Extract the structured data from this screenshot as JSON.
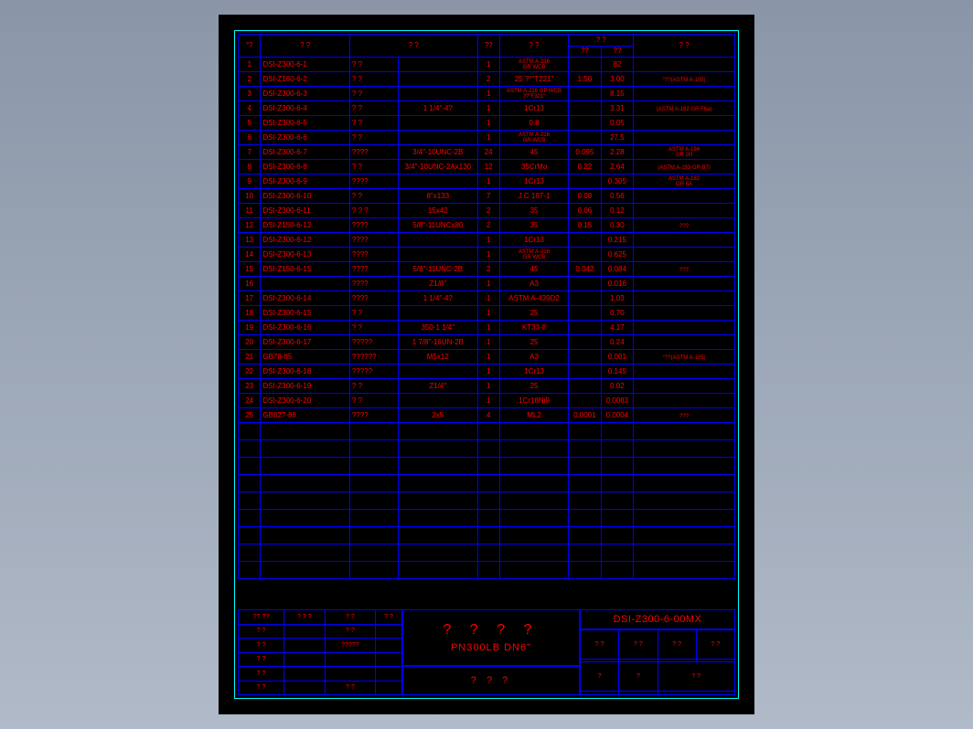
{
  "header": {
    "c1": "°?",
    "c2": "?    ?",
    "c3": "?    ?",
    "c4": "??",
    "c5": "?  ?",
    "c6a": "? ?",
    "c6b": "??",
    "c6c": "??",
    "c7": "?    ?"
  },
  "rows": [
    {
      "n": "1",
      "code": "DSI-Z300-6-1",
      "name": "?   ?",
      "spec": "",
      "qty": "1",
      "mat": "ASTM A-216\nGR WCB",
      "w1": "",
      "w2": "82",
      "rem": ""
    },
    {
      "n": "2",
      "code": "DSI-Z150-6-2",
      "name": "?   ?",
      "spec": "",
      "qty": "2",
      "mat": "25 ?°\"T221\"",
      "w1": "1.50",
      "w2": "3.00",
      "rem": "°??(ASTM A-105)"
    },
    {
      "n": "3",
      "code": "DSI-Z300-6-3",
      "name": "?   ?",
      "spec": "",
      "qty": "1",
      "mat": "ASTM A-216 GP WCB\n??\"F321\"",
      "w1": "",
      "w2": "8.15",
      "rem": ""
    },
    {
      "n": "4",
      "code": "DSI-Z300-6-4",
      "name": "?   ?",
      "spec": "1 1/4\"-4?",
      "qty": "1",
      "mat": "1Cr13",
      "w1": "",
      "w2": "3.31",
      "rem": "(ASTM A-182 GR F6a)"
    },
    {
      "n": "5",
      "code": "DSI-Z300-6-5",
      "name": "?   ?",
      "spec": "",
      "qty": "1",
      "mat": "0.8",
      "w1": "",
      "w2": "0.05",
      "rem": ""
    },
    {
      "n": "6",
      "code": "DSI-Z300-6-6",
      "name": "?   ?",
      "spec": "",
      "qty": "1",
      "mat": "ASTM A-216\nGR WCB",
      "w1": "",
      "w2": "27.5",
      "rem": ""
    },
    {
      "n": "7",
      "code": "DSI-Z300-6-7",
      "name": "????",
      "spec": "3/4\"-10UNC-2B",
      "qty": "24",
      "mat": "45",
      "w1": "0.095",
      "w2": "2.28",
      "rem": "ASTM A-194\nGR 2H"
    },
    {
      "n": "8",
      "code": "DSI-Z300-6-8",
      "name": "?   ?",
      "spec": "3/4\"-10UNC-2Ax130",
      "qty": "12",
      "mat": "35CrMo",
      "w1": "0.22",
      "w2": "2.64",
      "rem": "(ASTM A-193 GR B7)"
    },
    {
      "n": "9",
      "code": "DSI-Z300-6-9",
      "name": "????",
      "spec": "",
      "qty": "1",
      "mat": "1Cr13",
      "w1": "",
      "w2": "0.305",
      "rem": "ASTM A-182\nGR 6A"
    },
    {
      "n": "10",
      "code": "DSI-Z300-6-10",
      "name": "?   ?",
      "spec": "8\"x133",
      "qty": "7",
      "mat": "J.C 187-1",
      "w1": "0.08",
      "w2": "0.56",
      "rem": ""
    },
    {
      "n": "11",
      "code": "DSI-Z300-6-11",
      "name": "? ? ?",
      "spec": "15x42",
      "qty": "2",
      "mat": "35",
      "w1": "0.06",
      "w2": "0.12",
      "rem": ""
    },
    {
      "n": "12",
      "code": "DSI-Z150-6-12",
      "name": "????",
      "spec": "5/8\"-11UNCx80",
      "qty": "2",
      "mat": "35",
      "w1": "0.15",
      "w2": "0.30",
      "rem": "???"
    },
    {
      "n": "13",
      "code": "DSI-Z300-6-12",
      "name": "????",
      "spec": "",
      "qty": "1",
      "mat": "1Cr13",
      "w1": "",
      "w2": "0.215",
      "rem": ""
    },
    {
      "n": "14",
      "code": "DSI-Z300-6-13",
      "name": "????",
      "spec": "",
      "qty": "1",
      "mat": "ASTM A-216\nGR WCB",
      "w1": "",
      "w2": "0.625",
      "rem": ""
    },
    {
      "n": "15",
      "code": "DSI-Z150-6-15",
      "name": "????",
      "spec": "5/8\"-11UNC-2B",
      "qty": "2",
      "mat": "45",
      "w1": "0.042",
      "w2": "0.084",
      "rem": "???"
    },
    {
      "n": "16",
      "code": "",
      "name": "????",
      "spec": "Z1/8\"",
      "qty": "1",
      "mat": "A3",
      "w1": "",
      "w2": "0.016",
      "rem": ""
    },
    {
      "n": "17",
      "code": "DSI-Z300-6-14",
      "name": "????",
      "spec": "1 1/4\"-4?",
      "qty": "1",
      "mat": "ASTM A-439D2",
      "w1": "",
      "w2": "1.03",
      "rem": ""
    },
    {
      "n": "18",
      "code": "DSI-Z300-6-15",
      "name": "?   ?",
      "spec": "",
      "qty": "1",
      "mat": "25",
      "w1": "",
      "w2": "0.70",
      "rem": ""
    },
    {
      "n": "19",
      "code": "DSI-Z300-6-16",
      "name": "?   ?",
      "spec": "350-1 1/4\"",
      "qty": "1",
      "mat": "KT33-8",
      "w1": "",
      "w2": "4.17",
      "rem": ""
    },
    {
      "n": "20",
      "code": "DSI-Z300-6-17",
      "name": "?????",
      "spec": "1 7/8\"-16UN-2B",
      "qty": "1",
      "mat": "25",
      "w1": "",
      "w2": "0.24",
      "rem": ""
    },
    {
      "n": "21",
      "code": "GB78-85",
      "name": "??????",
      "spec": "M5x12",
      "qty": "1",
      "mat": "A3",
      "w1": "",
      "w2": "0.001",
      "rem": "°??(ASTM A-105)"
    },
    {
      "n": "22",
      "code": "DSI-Z300-6-18",
      "name": "?????",
      "spec": "",
      "qty": "1",
      "mat": "1Cr13",
      "w1": "",
      "w2": "0.145",
      "rem": ""
    },
    {
      "n": "23",
      "code": "DSI-Z300-6-19",
      "name": "?   ?",
      "spec": "Z1/4\"",
      "qty": "1",
      "mat": "25",
      "w1": "",
      "w2": "0.02",
      "rem": ""
    },
    {
      "n": "24",
      "code": "DSI-Z300-6-20",
      "name": "?   ?",
      "spec": "",
      "qty": "1",
      "mat": "1Cr18Ni9",
      "w1": "",
      "w2": "0.0083",
      "rem": ""
    },
    {
      "n": "25",
      "code": "GB827-86",
      "name": "????",
      "spec": "2x5",
      "qty": "4",
      "mat": "ML2",
      "w1": "0.0001",
      "w2": "0.0004",
      "rem": "???"
    }
  ],
  "empty_rows": 9,
  "title_block": {
    "left_rows": [
      [
        "?? ??",
        "? ? ?",
        "? ?",
        "? ?"
      ],
      [
        "? ?",
        "",
        "? ?",
        ""
      ],
      [
        "? ?",
        "",
        "?????",
        ""
      ],
      [
        "? ?",
        "",
        "",
        ""
      ],
      [
        "? ?",
        "",
        "",
        ""
      ],
      [
        "? ?",
        "",
        "? ?",
        ""
      ]
    ],
    "title_main": "?  ?  ?  ?",
    "title_sub": "PN300LB DN6\"",
    "company": "?  ?  ?",
    "drawing_no": "DSI-Z300-6-00MX",
    "right_row1": [
      "? ?",
      "? ?",
      "? ?",
      "? ?"
    ],
    "right_row2": [
      "",
      "",
      "",
      ""
    ],
    "right_row3": [
      "?",
      "?",
      "? ?"
    ],
    "right_row4": [
      "",
      "",
      ""
    ]
  }
}
